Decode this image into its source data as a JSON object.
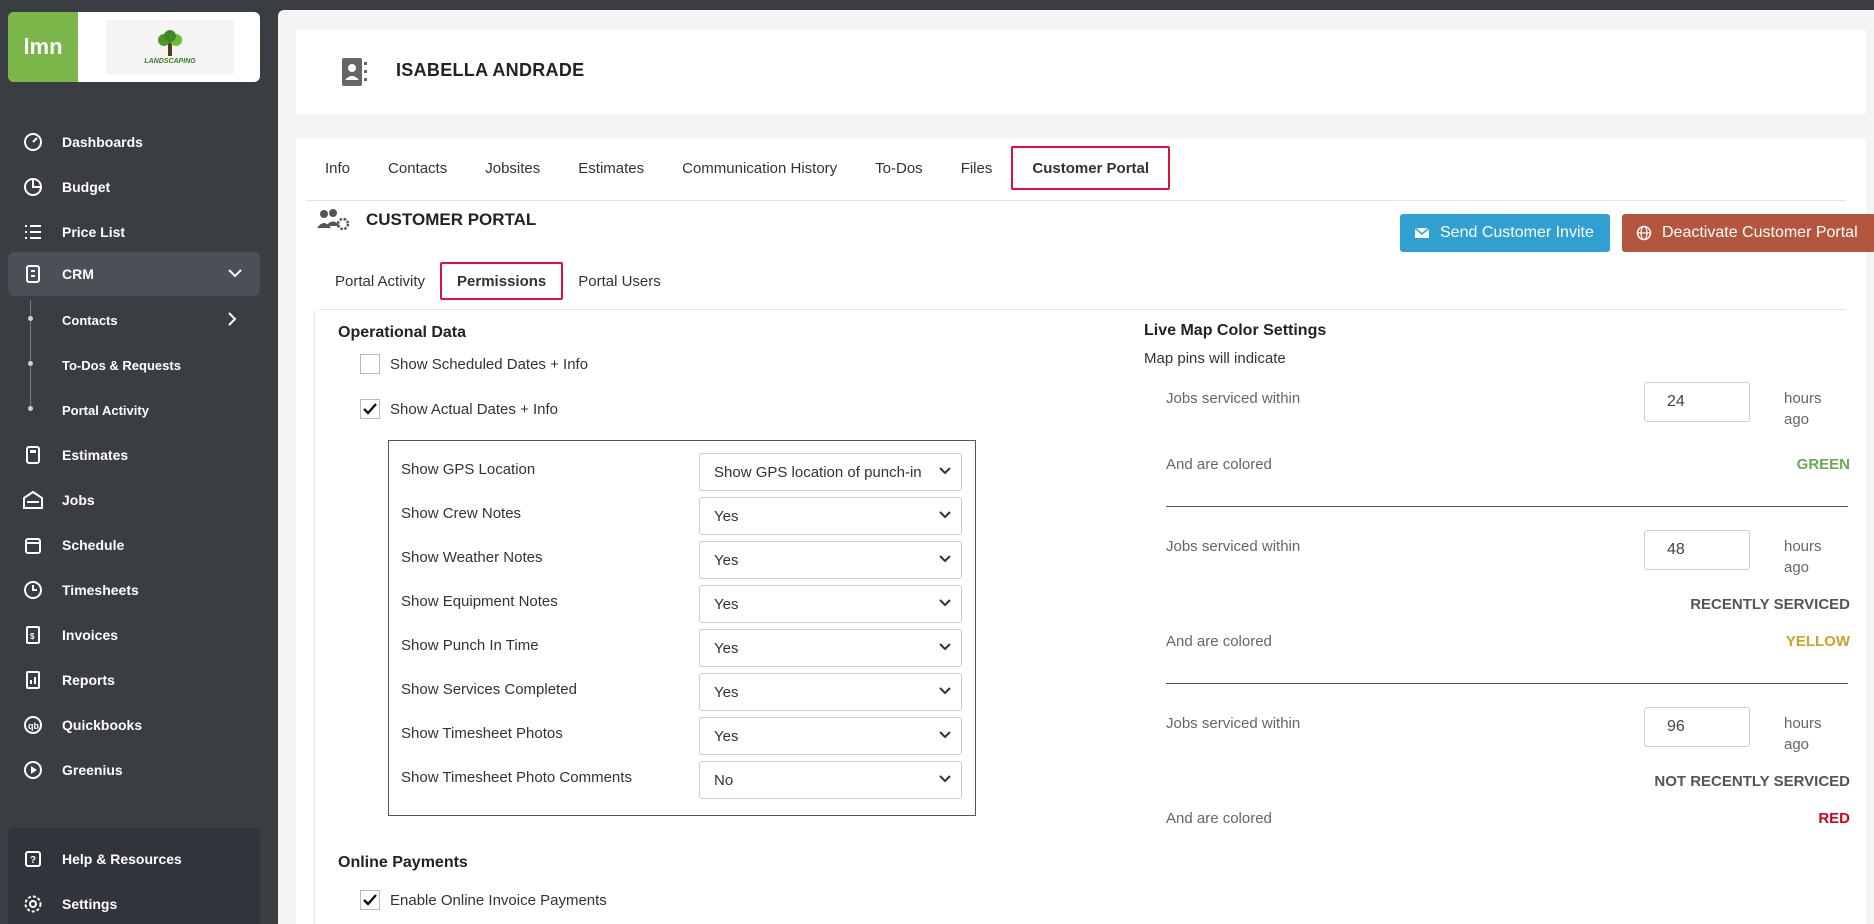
{
  "brand": {
    "app_name": "lmn",
    "logo_text": "LANDSCAPING"
  },
  "sidebar": {
    "items": [
      {
        "label": "Dashboards",
        "icon": "dashboard-icon"
      },
      {
        "label": "Budget",
        "icon": "pie-chart-icon"
      },
      {
        "label": "Price List",
        "icon": "list-icon"
      },
      {
        "label": "CRM",
        "icon": "crm-icon"
      },
      {
        "label": "Estimates",
        "icon": "calculator-icon"
      },
      {
        "label": "Jobs",
        "icon": "jobs-icon"
      },
      {
        "label": "Schedule",
        "icon": "calendar-icon"
      },
      {
        "label": "Timesheets",
        "icon": "clock-icon"
      },
      {
        "label": "Invoices",
        "icon": "invoice-icon"
      },
      {
        "label": "Reports",
        "icon": "report-icon"
      },
      {
        "label": "Quickbooks",
        "icon": "quickbooks-icon"
      },
      {
        "label": "Greenius",
        "icon": "play-icon"
      }
    ],
    "crm_sub": [
      {
        "label": "Contacts"
      },
      {
        "label": "To-Dos & Requests"
      },
      {
        "label": "Portal Activity"
      }
    ],
    "bottom": [
      {
        "label": "Help & Resources",
        "icon": "help-icon"
      },
      {
        "label": "Settings",
        "icon": "gear-icon"
      }
    ]
  },
  "header": {
    "title": "ISABELLA ANDRADE"
  },
  "tabs": [
    "Info",
    "Contacts",
    "Jobsites",
    "Estimates",
    "Communication History",
    "To-Dos",
    "Files",
    "Customer Portal"
  ],
  "portal": {
    "title": "CUSTOMER PORTAL",
    "send_invite": "Send Customer Invite",
    "deactivate": "Deactivate Customer Portal",
    "subtabs": [
      "Portal Activity",
      "Permissions",
      "Portal Users"
    ]
  },
  "operational": {
    "title": "Operational Data",
    "show_scheduled": "Show Scheduled Dates + Info",
    "show_actual": "Show Actual Dates + Info",
    "rows": [
      {
        "label": "Show GPS Location",
        "value": "Show GPS location of punch-in"
      },
      {
        "label": "Show Crew Notes",
        "value": "Yes"
      },
      {
        "label": "Show Weather Notes",
        "value": "Yes"
      },
      {
        "label": "Show Equipment Notes",
        "value": "Yes"
      },
      {
        "label": "Show Punch In Time",
        "value": "Yes"
      },
      {
        "label": "Show Services Completed",
        "value": "Yes"
      },
      {
        "label": "Show Timesheet Photos",
        "value": "Yes"
      },
      {
        "label": "Show Timesheet Photo Comments",
        "value": "No"
      }
    ]
  },
  "online_payments": {
    "title": "Online Payments",
    "enable": "Enable Online Invoice Payments"
  },
  "live_map": {
    "title": "Live Map Color Settings",
    "subtitle": "Map pins will indicate",
    "within_label": "Jobs serviced within",
    "unit_1": "hours",
    "unit_2": "ago",
    "colored_label": "And are colored",
    "groups": [
      {
        "hours": "24",
        "status": "",
        "color": "GREEN",
        "color_hex": "#6aa84f"
      },
      {
        "hours": "48",
        "status": "RECENTLY SERVICED",
        "color": "YELLOW",
        "color_hex": "#c9a227"
      },
      {
        "hours": "96",
        "status": "NOT RECENTLY SERVICED",
        "color": "RED",
        "color_hex": "#d0021b"
      }
    ]
  }
}
